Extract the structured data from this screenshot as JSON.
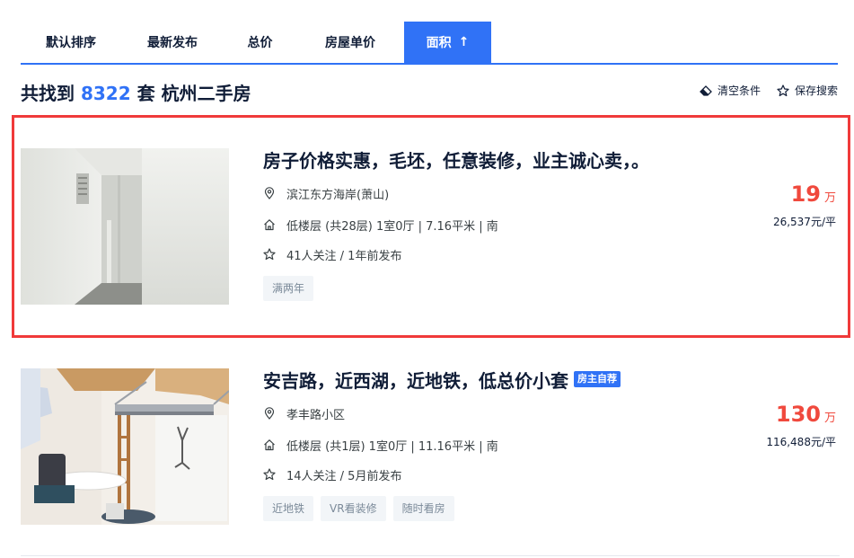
{
  "sort_tabs": {
    "default": "默认排序",
    "newest": "最新发布",
    "total_price": "总价",
    "unit_price": "房屋单价",
    "area": "面积",
    "area_arrow": "↑"
  },
  "summary": {
    "prefix": "共找到",
    "count": "8322",
    "suffix": "套 杭州二手房"
  },
  "actions": {
    "clear": "清空条件",
    "save": "保存搜索"
  },
  "listings": [
    {
      "title": "房子价格实惠，毛坯，任意装修，业主诚心卖，。",
      "badge": "",
      "community": "滨江东方海岸(萧山)",
      "detail": "低楼层 (共28层) 1室0厅 | 7.16平米 | 南",
      "follow": "41人关注 / 1年前发布",
      "tags": [
        "满两年"
      ],
      "price": "19",
      "price_unit": "万",
      "unit_price": "26,537元/平"
    },
    {
      "title": "安吉路，近西湖，近地铁，低总价小套",
      "badge": "房主自荐",
      "community": "孝丰路小区",
      "detail": "低楼层 (共1层) 1室0厅 | 11.16平米 | 南",
      "follow": "14人关注 / 5月前发布",
      "tags": [
        "近地铁",
        "VR看装修",
        "随时看房"
      ],
      "price": "130",
      "price_unit": "万",
      "unit_price": "116,488元/平"
    }
  ],
  "colors": {
    "accent": "#3072f6",
    "price": "#f0493d",
    "highlight": "#f03a3a"
  }
}
